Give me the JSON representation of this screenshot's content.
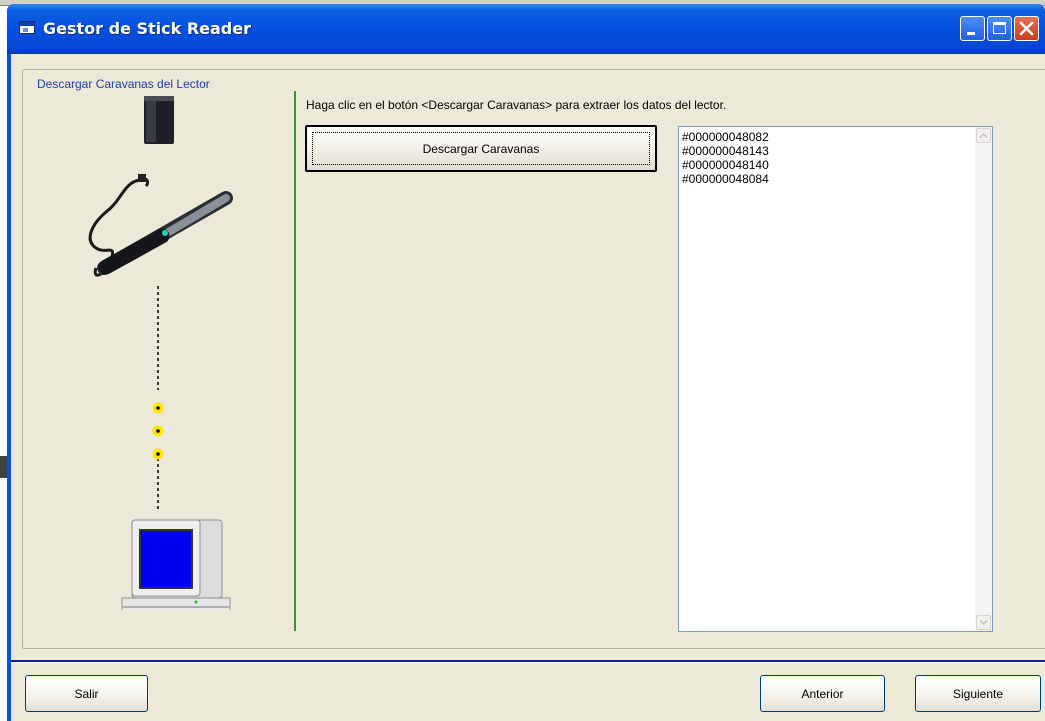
{
  "window": {
    "title": "Gestor de Stick Reader"
  },
  "group": {
    "title": "Descargar Caravanas del Lector"
  },
  "instruction": "Haga clic en el botón <Descargar Caravanas> para extraer los datos del lector.",
  "download_button_label": "Descargar Caravanas",
  "tags": [
    "#000000048082",
    "#000000048143",
    "#000000048140",
    "#000000048084"
  ],
  "footer": {
    "exit_label": "Salir",
    "back_label": "Anterior",
    "next_label": "Siguiente"
  },
  "icons": {
    "app": "app-window-icon",
    "minimize": "minimize-icon",
    "maximize": "maximize-icon",
    "close": "close-icon",
    "reader": "stick-reader-illustration",
    "computer": "computer-illustration"
  },
  "colors": {
    "titlebar": "#0450e0",
    "client_background": "#ece9d8",
    "group_title": "#1e3cb4",
    "accent_line": "#3c8e3c",
    "separator": "#0a1f8f",
    "dot": "#ffe600",
    "monitor_screen": "#0000f0"
  }
}
